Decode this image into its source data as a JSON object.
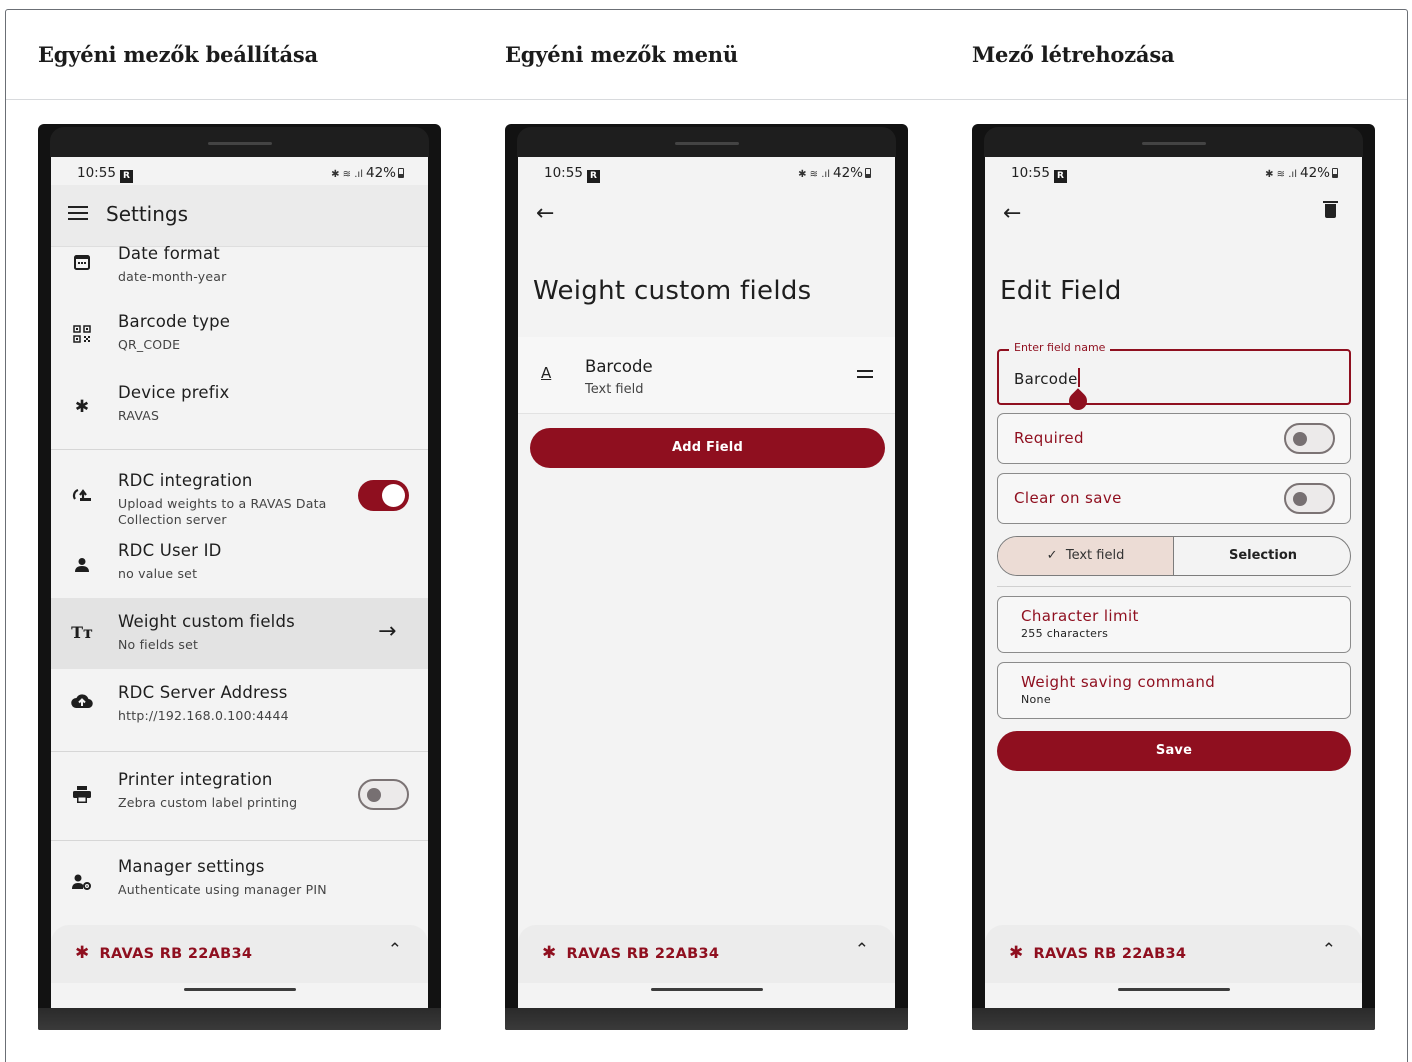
{
  "columns": [
    {
      "title": "Egyéni mezők beállítása"
    },
    {
      "title": "Egyéni mezők menü"
    },
    {
      "title": "Mező létrehozása"
    }
  ],
  "status_bar": {
    "time": "10:55",
    "badge": "R",
    "battery": "42%"
  },
  "settings": {
    "title": "Settings",
    "items": [
      {
        "label": "Date format",
        "value": "date-month-year",
        "icon": "calendar-icon"
      },
      {
        "label": "Barcode type",
        "value": "QR_CODE",
        "icon": "qr-code-icon"
      },
      {
        "label": "Device prefix",
        "value": "RAVAS",
        "icon": "bluetooth-icon"
      },
      {
        "label": "RDC integration",
        "value": "Upload weights to a RAVAS Data",
        "value2": "Collection server",
        "icon": "cloud-sync-icon",
        "toggle": true
      },
      {
        "label": "RDC User ID",
        "value": "no value set",
        "icon": "person-icon"
      },
      {
        "label": "Weight custom fields",
        "value": "No fields set",
        "icon": "text-size-icon"
      },
      {
        "label": "RDC Server Address",
        "value": "http://192.168.0.100:4444",
        "icon": "cloud-upload-icon"
      },
      {
        "label": "Printer integration",
        "value": "Zebra custom label printing",
        "icon": "printer-icon",
        "toggle": false
      },
      {
        "label": "Manager settings",
        "value": "Authenticate using manager PIN",
        "icon": "manager-icon"
      }
    ]
  },
  "device_bar": {
    "name": "RAVAS RB 22AB34"
  },
  "custom_fields": {
    "title": "Weight custom fields",
    "field": {
      "name": "Barcode",
      "type": "Text field",
      "type_icon": "A"
    },
    "add_button": "Add Field"
  },
  "edit_field": {
    "title": "Edit Field",
    "name_label": "Enter field name",
    "name_value": "Barcode",
    "required_label": "Required",
    "required_on": false,
    "clear_label": "Clear on save",
    "clear_on": false,
    "segment": {
      "option_a": "Text field",
      "option_b": "Selection",
      "selected": "Text field",
      "check": "✓"
    },
    "char_limit": {
      "label": "Character limit",
      "value": "255 characters"
    },
    "save_cmd": {
      "label": "Weight saving command",
      "value": "None"
    },
    "save_button": "Save"
  },
  "colors": {
    "accent": "#8f0f1f",
    "segment_selected": "#ecdcd5"
  }
}
